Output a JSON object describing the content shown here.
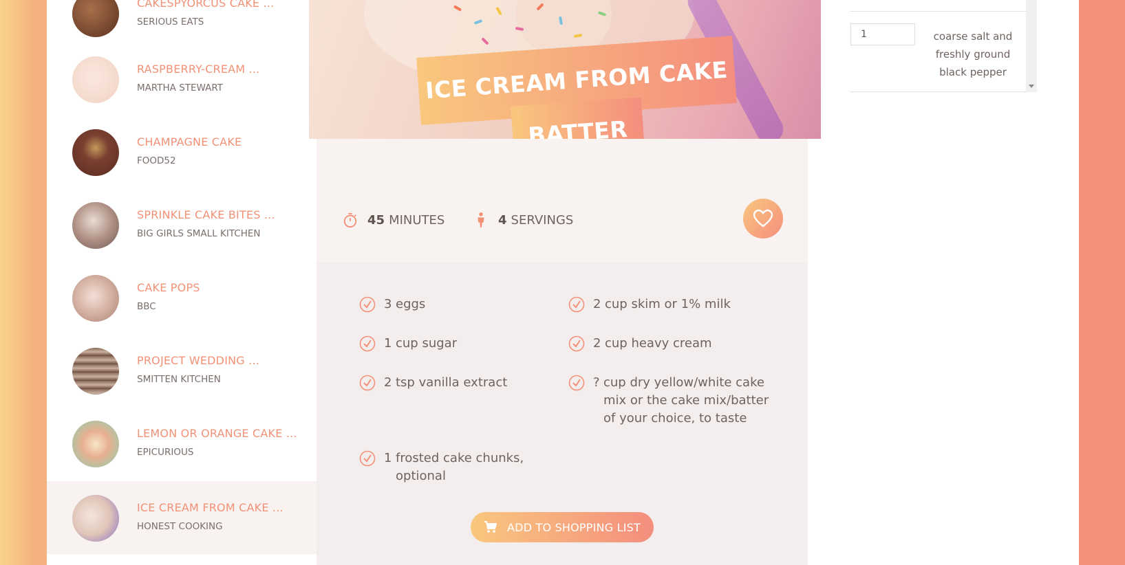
{
  "sidebar": {
    "items": [
      {
        "title": "CAKESPYORCUS CAKE ...",
        "source": "SERIOUS EATS",
        "thumb_color": "#8a5a3a"
      },
      {
        "title": "RASPBERRY-CREAM ...",
        "source": "MARTHA STEWART",
        "thumb_color": "#f4ddd2"
      },
      {
        "title": "CHAMPAGNE CAKE",
        "source": "FOOD52",
        "thumb_color": "#7a4030"
      },
      {
        "title": "SPRINKLE CAKE BITES ...",
        "source": "BIG GIRLS SMALL KITCHEN",
        "thumb_color": "#b89a90"
      },
      {
        "title": "CAKE POPS",
        "source": "BBC",
        "thumb_color": "#d8b6a8"
      },
      {
        "title": "PROJECT WEDDING ...",
        "source": "SMITTEN KITCHEN",
        "thumb_color": "#7b5f50"
      },
      {
        "title": "LEMON OR ORANGE CAKE ...",
        "source": "EPICURIOUS",
        "thumb_color": "#efd6b8"
      },
      {
        "title": "ICE CREAM FROM CAKE ...",
        "source": "HONEST COOKING",
        "thumb_color": "#e8d4cc"
      }
    ]
  },
  "recipe": {
    "title_line1": "ICE CREAM FROM CAKE",
    "title_line2": "BATTER",
    "minutes_value": "45",
    "minutes_label": "MINUTES",
    "servings_value": "4",
    "servings_label": "SERVINGS"
  },
  "ingredients": [
    {
      "qty": "3",
      "text": "eggs"
    },
    {
      "qty": "2",
      "text": "cup skim or 1% milk"
    },
    {
      "qty": "1",
      "text": "cup sugar"
    },
    {
      "qty": "2",
      "text": "cup heavy cream"
    },
    {
      "qty": "2",
      "text": "tsp vanilla extract"
    },
    {
      "qty": "?",
      "text_lines": [
        "cup dry yellow/white cake",
        "mix or the cake mix/batter",
        "of your choice, to taste"
      ]
    },
    {
      "qty": "1",
      "text_lines": [
        "frosted cake chunks,",
        "optional"
      ]
    }
  ],
  "actions": {
    "shopping_list_label": "ADD TO SHOPPING LIST"
  },
  "shopping_panel": {
    "qty_value": "1",
    "ingredient_lines": [
      "coarse salt and",
      "freshly ground",
      "black pepper"
    ]
  },
  "colors": {
    "accent": "#f29176",
    "gradient_start": "#f9c77e",
    "gradient_end": "#f48e7e"
  }
}
